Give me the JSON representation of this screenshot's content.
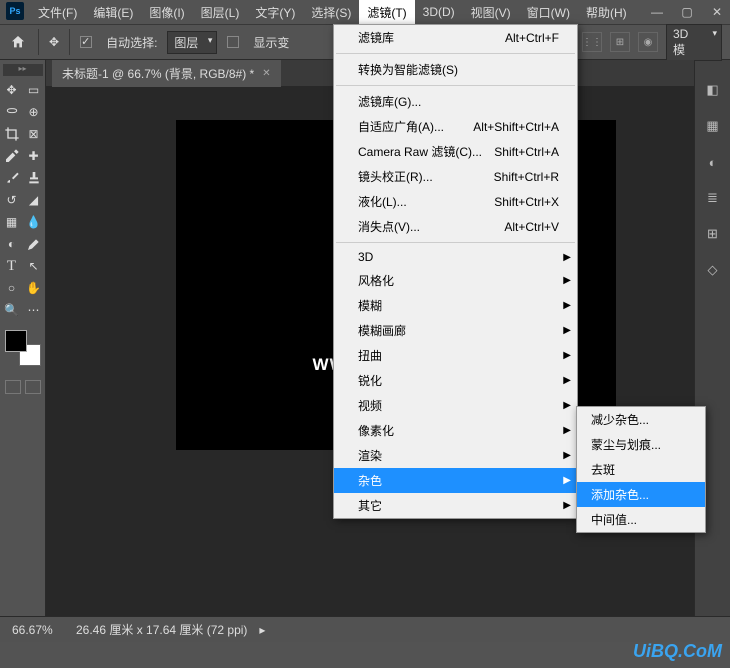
{
  "window": {
    "min": "—",
    "max": "▢",
    "close": "✕"
  },
  "app": {
    "logo": "Ps"
  },
  "menubar": {
    "file": "文件(F)",
    "edit": "编辑(E)",
    "image": "图像(I)",
    "layer": "图层(L)",
    "type": "文字(Y)",
    "select": "选择(S)",
    "filter": "滤镜(T)",
    "threeD": "3D(D)",
    "view": "视图(V)",
    "window": "窗口(W)",
    "help": "帮助(H)"
  },
  "options": {
    "auto_select_label": "自动选择:",
    "layer_dropdown": "图层",
    "show_transform": "显示变",
    "threeD_mode": "3D 模"
  },
  "doc": {
    "tab_title": "未标题-1 @ 66.7% (背景, RGB/8#) *",
    "watermark_text": "WWW.PSAHZ.COM"
  },
  "status": {
    "zoom": "66.67%",
    "doc_info": "26.46 厘米 x 17.64 厘米 (72 ppi)"
  },
  "filter_menu": {
    "last": {
      "label": "滤镜库",
      "shortcut": "Alt+Ctrl+F"
    },
    "smart": "转换为智能滤镜(S)",
    "gallery": "滤镜库(G)...",
    "adaptive": {
      "label": "自适应广角(A)...",
      "shortcut": "Alt+Shift+Ctrl+A"
    },
    "camera_raw": {
      "label": "Camera Raw 滤镜(C)...",
      "shortcut": "Shift+Ctrl+A"
    },
    "lens": {
      "label": "镜头校正(R)...",
      "shortcut": "Shift+Ctrl+R"
    },
    "liquify": {
      "label": "液化(L)...",
      "shortcut": "Shift+Ctrl+X"
    },
    "vanish": {
      "label": "消失点(V)...",
      "shortcut": "Alt+Ctrl+V"
    },
    "sub_3d": "3D",
    "sub_stylize": "风格化",
    "sub_blur": "模糊",
    "sub_blur_gallery": "模糊画廊",
    "sub_distort": "扭曲",
    "sub_sharpen": "锐化",
    "sub_video": "视频",
    "sub_pixelate": "像素化",
    "sub_render": "渲染",
    "sub_noise": "杂色",
    "sub_other": "其它"
  },
  "noise_submenu": {
    "reduce": "减少杂色...",
    "dust": "蒙尘与划痕...",
    "despeckle": "去斑",
    "add": "添加杂色...",
    "median": "中间值..."
  },
  "brand": "UiBQ.CoM"
}
